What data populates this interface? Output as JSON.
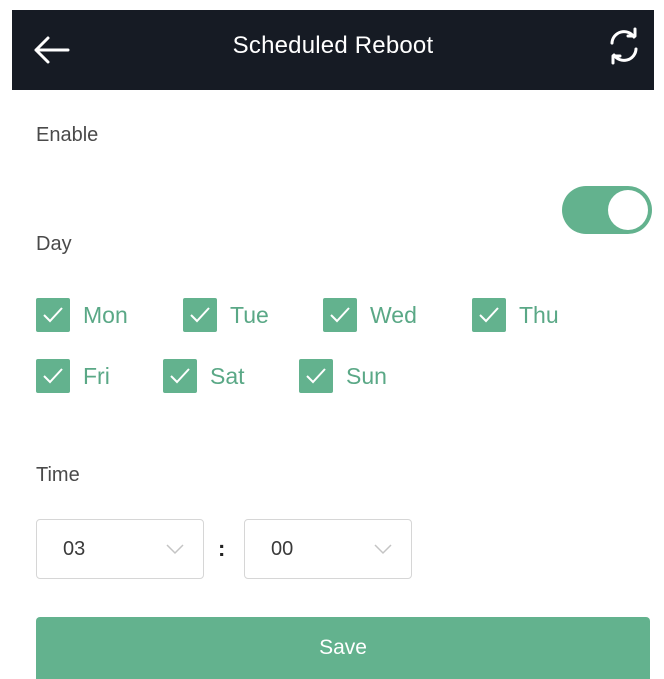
{
  "header": {
    "title": "Scheduled Reboot",
    "back_icon": "arrow-left-icon",
    "refresh_icon": "refresh-icon",
    "background": "#161b24"
  },
  "enable": {
    "label": "Enable",
    "value": true
  },
  "day": {
    "label": "Day",
    "days": [
      {
        "label": "Mon",
        "checked": true
      },
      {
        "label": "Tue",
        "checked": true
      },
      {
        "label": "Wed",
        "checked": true
      },
      {
        "label": "Thu",
        "checked": true
      },
      {
        "label": "Fri",
        "checked": true
      },
      {
        "label": "Sat",
        "checked": true
      },
      {
        "label": "Sun",
        "checked": true
      }
    ]
  },
  "time": {
    "label": "Time",
    "hour": "03",
    "separator": ":",
    "minute": "00"
  },
  "save_label": "Save",
  "colors": {
    "accent": "#63b28e",
    "accent_text": "#5aa886"
  }
}
